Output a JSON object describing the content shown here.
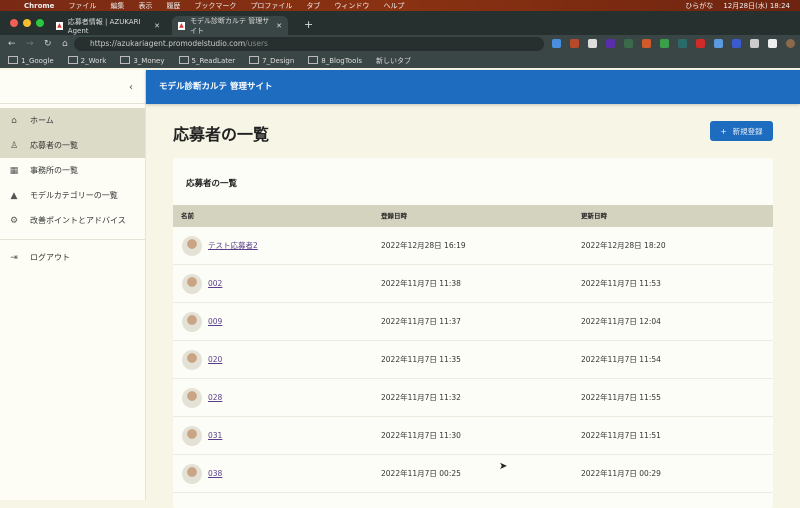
{
  "menubar": {
    "app": "Chrome",
    "items": [
      "ファイル",
      "編集",
      "表示",
      "履歴",
      "ブックマーク",
      "プロファイル",
      "タブ",
      "ウィンドウ",
      "ヘルプ"
    ],
    "ime": "ひらがな",
    "clock": "12月28日(水) 18:24"
  },
  "tabs": [
    {
      "label": "応募者情報 | AZUKARI Agent"
    },
    {
      "label": "モデル診断カルテ 管理サイト"
    }
  ],
  "address": {
    "scheme": "https://",
    "host": "azukariagent.promodelstudio.com",
    "path": "/users"
  },
  "bookmarks": [
    "1_Google",
    "2_Work",
    "3_Money",
    "5_ReadLater",
    "7_Design",
    "8_BlogTools",
    "新しいタブ"
  ],
  "sidebar": {
    "items": [
      {
        "label": "ホーム",
        "icon": "home-icon"
      },
      {
        "label": "応募者の一覧",
        "icon": "person-icon"
      },
      {
        "label": "事務所の一覧",
        "icon": "building-icon"
      },
      {
        "label": "モデルカテゴリーの一覧",
        "icon": "category-icon"
      },
      {
        "label": "改善ポイントとアドバイス",
        "icon": "gear-icon"
      }
    ],
    "logout": "ログアウト"
  },
  "appbar": {
    "title": "モデル診断カルテ 管理サイト"
  },
  "page": {
    "title": "応募者の一覧",
    "new_button": "新規登録"
  },
  "card": {
    "title": "応募者の一覧",
    "columns": [
      "名前",
      "登録日時",
      "更新日時"
    ],
    "rows": [
      {
        "name": "テスト応募者2",
        "created": "2022年12月28日 16:19",
        "updated": "2022年12月28日 18:20"
      },
      {
        "name": "002",
        "created": "2022年11月7日 11:38",
        "updated": "2022年11月7日 11:53"
      },
      {
        "name": "009",
        "created": "2022年11月7日 11:37",
        "updated": "2022年11月7日 12:04"
      },
      {
        "name": "020",
        "created": "2022年11月7日 11:35",
        "updated": "2022年11月7日 11:54"
      },
      {
        "name": "028",
        "created": "2022年11月7日 11:32",
        "updated": "2022年11月7日 11:55"
      },
      {
        "name": "031",
        "created": "2022年11月7日 11:30",
        "updated": "2022年11月7日 11:51"
      },
      {
        "name": "038",
        "created": "2022年11月7日 00:25",
        "updated": "2022年11月7日 00:29"
      }
    ]
  }
}
